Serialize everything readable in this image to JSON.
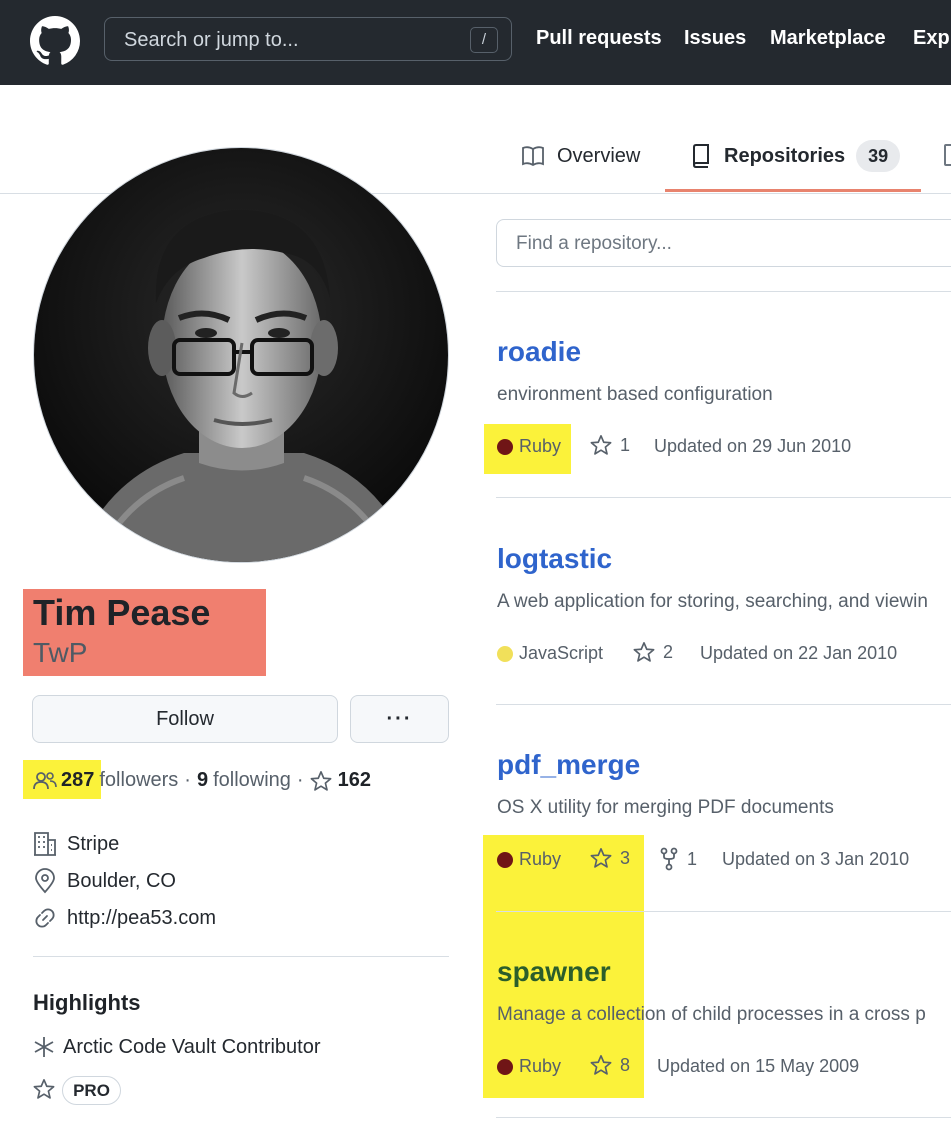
{
  "header": {
    "search_placeholder": "Search or jump to...",
    "search_shortcut": "/",
    "nav": [
      "Pull requests",
      "Issues",
      "Marketplace",
      "Expl"
    ]
  },
  "tabs": {
    "overview": "Overview",
    "repositories": "Repositories",
    "repositories_count": "39"
  },
  "profile": {
    "full_name": "Tim Pease",
    "login": "TwP",
    "follow_button": "Follow",
    "more_button": "···",
    "followers_count": "287",
    "followers_label": "followers",
    "separator": "·",
    "following_count": "9",
    "following_label": "following",
    "stars_count": "162",
    "company": "Stripe",
    "location": "Boulder, CO",
    "website": "http://pea53.com",
    "highlights_title": "Highlights",
    "highlight_item": "Arctic Code Vault Contributor",
    "pro_badge": "PRO"
  },
  "repos": {
    "search_placeholder": "Find a repository...",
    "items": [
      {
        "name": "roadie",
        "description": "environment based configuration",
        "language": "Ruby",
        "stars": "1",
        "updated": "Updated on 29 Jun 2010"
      },
      {
        "name": "logtastic",
        "description": "A web application for storing, searching, and viewin",
        "language": "JavaScript",
        "stars": "2",
        "updated": "Updated on 22 Jan 2010"
      },
      {
        "name": "pdf_merge",
        "description": "OS X utility for merging PDF documents",
        "language": "Ruby",
        "stars": "3",
        "forks": "1",
        "updated": "Updated on 3 Jan 2010"
      },
      {
        "name": "spawner",
        "description": "Manage a collection of child processes in a cross p",
        "language": "Ruby",
        "stars": "8",
        "updated": "Updated on 15 May 2009"
      }
    ]
  },
  "colors": {
    "header_bg": "#24292f",
    "link_blue": "#2f64cc",
    "ruby": "#701516",
    "javascript": "#f1e05a",
    "name_highlight": "#f07f6f",
    "yellow_highlight": "#fbf23a",
    "tab_underline": "#e8836e"
  }
}
